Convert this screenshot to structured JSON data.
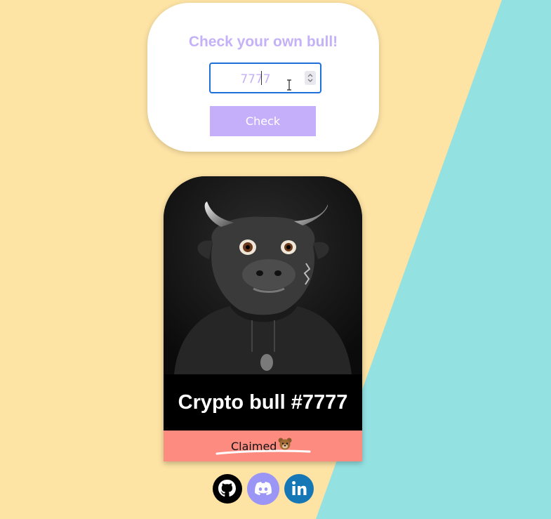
{
  "check_panel": {
    "title": "Check your own bull!",
    "input_value": "7777",
    "button_label": "Check"
  },
  "bull_card": {
    "name": "Crypto bull #7777",
    "status": "Claimed",
    "status_icon": "bear-face-icon"
  },
  "social_links": [
    {
      "name": "github",
      "icon": "github-icon"
    },
    {
      "name": "discord",
      "icon": "discord-icon"
    },
    {
      "name": "linkedin",
      "icon": "linkedin-icon"
    }
  ],
  "colors": {
    "background": "#fde3a4",
    "accent_teal": "#94e1e2",
    "accent_purple": "#c4b1f7",
    "status_coral": "#fd8b80",
    "input_border": "#1e6fd9"
  }
}
